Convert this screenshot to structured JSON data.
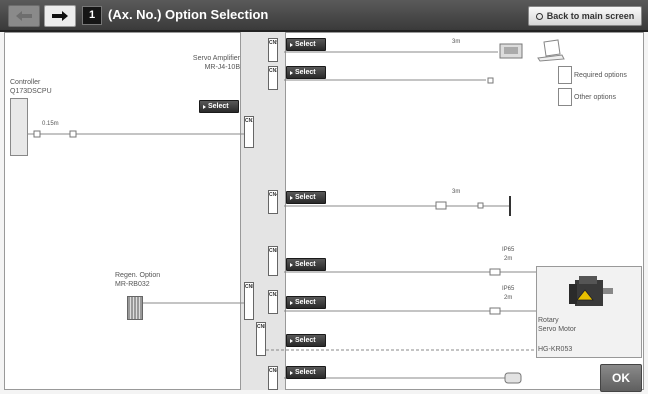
{
  "header": {
    "axis_no": "1",
    "title": "(Ax. No.) Option Selection",
    "back_label": "Back to main screen"
  },
  "controller": {
    "label": "Controller",
    "model": "Q173DSCPU"
  },
  "servo_amplifier": {
    "label": "Servo Amplifier",
    "model": "MR-J4-10B"
  },
  "cable_controller": "0.15m",
  "connectors": {
    "cn5": "CN5",
    "cn3": "CN3",
    "cn1a": "CN1A",
    "cn4": "CN4",
    "cnp3": "CNP3",
    "cn2": "CN2",
    "cnp2": "CNP2",
    "cnp1": "CNP1",
    "cn8": "CN8"
  },
  "select_label": "Select",
  "cable_lengths": {
    "cn5": "3m",
    "cn4": "3m",
    "power": "2m",
    "encoder": "2m"
  },
  "ip_ratings": {
    "power": "IP65",
    "encoder": "IP65"
  },
  "legend": {
    "required": "Required options",
    "other": "Other options"
  },
  "regen": {
    "label": "Regen. Option",
    "model": "MR-RB032"
  },
  "motor": {
    "label_line1": "Rotary",
    "label_line2": "Servo Motor",
    "model": "HG-KR053"
  },
  "ok_label": "OK",
  "colors": {
    "titlebar": "#3a3a3a",
    "button_dark": "#2a2a2a",
    "ok_button": "#6f6f6f"
  }
}
